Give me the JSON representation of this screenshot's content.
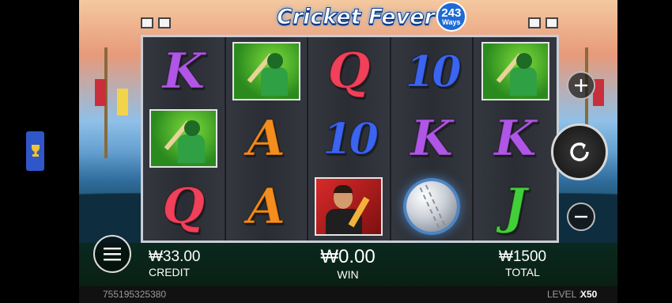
{
  "game": {
    "logo": {
      "title": "Cricket Fever",
      "ways_number": "243",
      "ways_label": "Ways"
    },
    "reels": [
      [
        "K",
        "batsman",
        "Q"
      ],
      [
        "batsman",
        "A",
        "A"
      ],
      [
        "Q",
        "10",
        "player"
      ],
      [
        "10",
        "K",
        "ball"
      ],
      [
        "batsman",
        "K",
        "J"
      ]
    ],
    "credit": {
      "value": "₩33.00",
      "label": "CREDIT"
    },
    "win": {
      "value": "₩0.00",
      "label": "WIN"
    },
    "total": {
      "value": "₩1500",
      "label": "TOTAL"
    },
    "session_id": "755195325380",
    "level": {
      "label": "LEVEL :",
      "value": "X50"
    },
    "buttons": {
      "menu_icon": "hamburger-icon",
      "plus_icon": "plus-icon",
      "spin_icon": "spin-arrow-icon",
      "minus_icon": "minus-icon",
      "trophy_icon": "trophy-icon"
    }
  }
}
